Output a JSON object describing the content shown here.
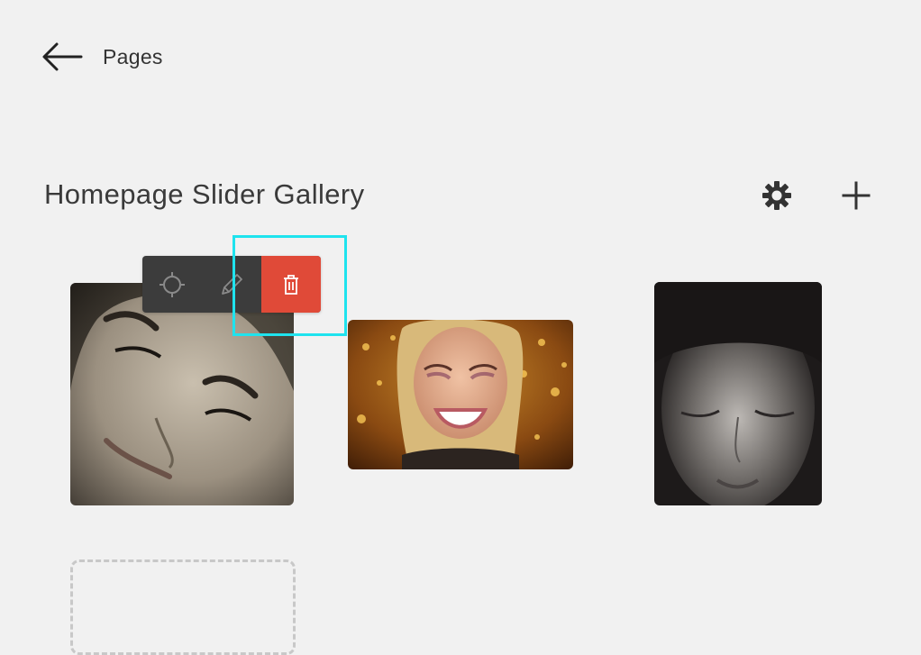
{
  "nav": {
    "back_label": "Pages",
    "back_icon": "arrow-left-icon"
  },
  "header": {
    "title": "Homepage Slider Gallery",
    "settings_icon": "gear-icon",
    "add_icon": "plus-icon"
  },
  "gallery": {
    "items": [
      {
        "description_icon": "image-thumbnail",
        "tone": "sepia-bw"
      },
      {
        "description_icon": "image-thumbnail",
        "tone": "color"
      },
      {
        "description_icon": "image-thumbnail",
        "tone": "dark-bw"
      }
    ],
    "toolbar": {
      "actions": [
        "focal-point-icon",
        "pencil-icon",
        "trash-icon"
      ],
      "delete_color": "#e04a38",
      "bg_color": "#3c3c3c"
    }
  },
  "colors": {
    "background": "#f1f1f1",
    "highlight": "#1fe3ee",
    "text": "#333333"
  }
}
